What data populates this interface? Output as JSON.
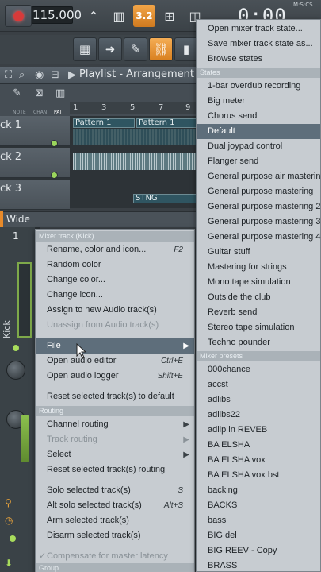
{
  "toolbar": {
    "tempo": "115.000",
    "pattern_label": "3.2",
    "time": "0:00",
    "time_unit": "M:S:CS"
  },
  "playlist": {
    "title": "Playlist - Arrangement",
    "ruler": [
      "1",
      "3",
      "5",
      "7",
      "9"
    ],
    "mini_labels": [
      "NOTE",
      "CHAN",
      "PAT"
    ],
    "tracks": [
      {
        "label": "ck 1",
        "patterns": [
          "Pattern 1",
          "Pattern 1"
        ]
      },
      {
        "label": "ck 2",
        "patterns": []
      },
      {
        "label": "ck 3",
        "patterns": [
          "STNG"
        ]
      }
    ]
  },
  "mixer": {
    "view_label": "Wide",
    "track_number": "1",
    "track_name": "Kick"
  },
  "left_menu": {
    "header": "Mixer track (Kick)",
    "items": [
      {
        "label": "Rename, color and icon...",
        "shortcut": "F2",
        "disabled": false
      },
      {
        "label": "Random color",
        "shortcut": "",
        "disabled": false
      },
      {
        "label": "Change color...",
        "shortcut": "",
        "disabled": false
      },
      {
        "label": "Change icon...",
        "shortcut": "",
        "disabled": false
      },
      {
        "label": "Assign to new Audio track(s)",
        "shortcut": "",
        "disabled": false
      },
      {
        "label": "Unassign from Audio track(s)",
        "shortcut": "",
        "disabled": true
      }
    ],
    "file_label": "File",
    "file_items": [
      {
        "label": "Open audio editor",
        "shortcut": "Ctrl+E"
      },
      {
        "label": "Open audio logger",
        "shortcut": "Shift+E"
      }
    ],
    "reset_label": "Reset selected track(s) to default",
    "routing_header": "Routing",
    "routing_items": [
      {
        "label": "Channel routing",
        "submenu": true,
        "disabled": false
      },
      {
        "label": "Track routing",
        "submenu": true,
        "disabled": true
      },
      {
        "label": "Select",
        "submenu": true,
        "disabled": false
      },
      {
        "label": "Reset selected track(s) routing",
        "submenu": false,
        "disabled": false
      }
    ],
    "solo_items": [
      {
        "label": "Solo selected track(s)",
        "shortcut": "S"
      },
      {
        "label": "Alt solo selected track(s)",
        "shortcut": "Alt+S"
      },
      {
        "label": "Arm selected track(s)",
        "shortcut": ""
      },
      {
        "label": "Disarm selected track(s)",
        "shortcut": ""
      }
    ],
    "latency_label": "Compensate for master latency",
    "group_header": "Group"
  },
  "right_menu": {
    "top_items": [
      "Open mixer track state...",
      "Save mixer track state as...",
      "Browse states"
    ],
    "states_header": "States",
    "states": [
      "1-bar overdub recording",
      "Big meter",
      "Chorus send",
      "Default",
      "Dual joypad control",
      "Flanger send",
      "General purpose air mastering",
      "General purpose mastering",
      "General purpose mastering 2",
      "General purpose mastering 3",
      "General purpose mastering 4",
      "Guitar stuff",
      "Mastering for strings",
      "Mono tape simulation",
      "Outside the club",
      "Reverb send",
      "Stereo tape simulation",
      "Techno pounder"
    ],
    "selected_state": "Default",
    "presets_header": "Mixer presets",
    "presets": [
      "000chance",
      "accst",
      "adlibs",
      "adlibs22",
      "adlip in REVEB",
      "BA ELSHA",
      "BA ELSHA vox",
      "BA ELSHA vox bst",
      "backing",
      "BACKS",
      "bass",
      "BIG del",
      "BIG REEV - Copy",
      "BRASS"
    ]
  },
  "colors": {
    "accent_orange": "#e88a2a",
    "menu_bg": "#c7ccd1",
    "highlight": "#5e6e7b",
    "led_green": "#a8dc5c"
  }
}
